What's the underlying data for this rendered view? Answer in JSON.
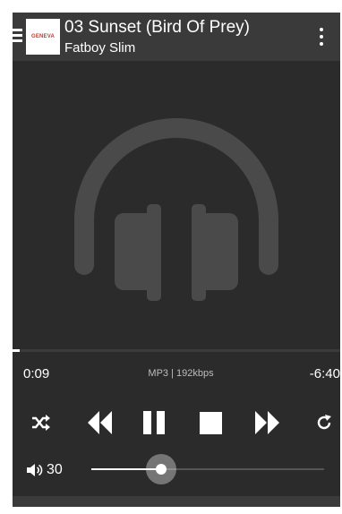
{
  "header": {
    "logo_text": "GENEVA",
    "title": "03 Sunset (Bird Of Prey)",
    "artist": "Fatboy Slim"
  },
  "artwork": {
    "icon": "headphones-icon",
    "color": "#4a4a4a"
  },
  "playback": {
    "elapsed": "0:09",
    "remaining": "-6:40",
    "format": "MP3 | 192kbps",
    "progress_fraction": 0.02
  },
  "controls": {
    "shuffle_icon": "shuffle-icon",
    "rewind_icon": "rewind-icon",
    "pause_icon": "pause-icon",
    "stop_icon": "stop-icon",
    "fast_forward_icon": "fast-forward-icon",
    "repeat_icon": "repeat-icon"
  },
  "volume": {
    "icon": "speaker-icon",
    "value": "30",
    "fraction": 0.3
  },
  "colors": {
    "background": "#2b2b2b",
    "header": "#3a3a3a",
    "foreground": "#ffffff"
  }
}
